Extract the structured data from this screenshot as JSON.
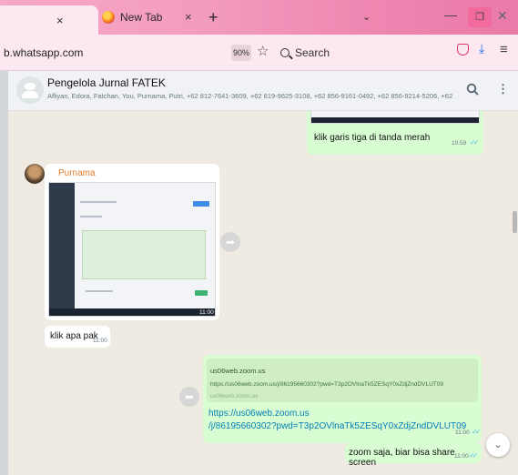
{
  "browser": {
    "tab_active_close": "×",
    "tab2_title": "New Tab",
    "tab2_close": "×",
    "new_tab": "+",
    "tabs_chevron": "⌄",
    "url": "b.whatsapp.com",
    "zoom": "90%",
    "search_placeholder": "Search",
    "win_min": "—",
    "win_max": "❐",
    "win_close": "✕",
    "menu_icon": "≡"
  },
  "chat_header": {
    "name": "Pengelola Jurnal FATEK",
    "members": "Afliyan, Edora, Fatchan, You, Purnama, Putri, +62 812-7641-3609, +62 819-9625-3108, +62 856-9161-0492, +62 856-9214-5206, +62 857-3030-4025, +62 8..."
  },
  "messages": {
    "m1": {
      "text": "klik garis tiga di tanda merah",
      "time": "10:59"
    },
    "m2": {
      "sender": "Purnama",
      "image_time": "11:00"
    },
    "m3": {
      "text": "klik apa pak",
      "time": "11:00"
    },
    "m4": {
      "preview_domain": "us06web.zoom.us",
      "preview_url": "https://us06web.zoom.us/j/86195660302?pwd=T3p2OVlnaTk5ZESqY0xZdjZndDVLUT09",
      "preview_site": "us06web.zoom.us",
      "link_line1": "https://us06web.zoom.us",
      "link_line2": "/j/86195660302?pwd=T3p2OVlnaTk5ZESqY0xZdjZndDVLUT09",
      "time": "11:00"
    },
    "m5": {
      "text": "zoom saja, biar bisa share screen",
      "time": "11:00"
    }
  },
  "colors": {
    "outgoing": "#d9fdd3",
    "sender_name": "#e07b2e",
    "ticks": "#53bdeb"
  }
}
